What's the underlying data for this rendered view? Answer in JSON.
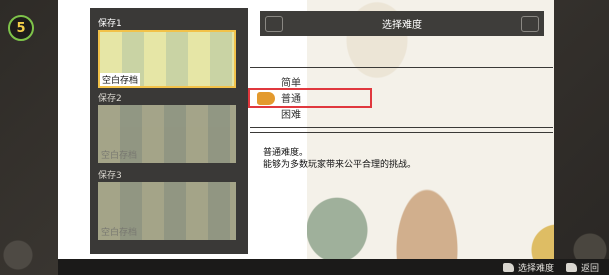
{
  "header": {
    "title": "选择难度"
  },
  "save_slots": [
    {
      "label": "保存1",
      "status": "空白存档",
      "selected": true
    },
    {
      "label": "保存2",
      "status": "空白存档",
      "selected": false
    },
    {
      "label": "保存3",
      "status": "空白存档",
      "selected": false
    }
  ],
  "difficulty": {
    "options": [
      "简单",
      "普通",
      "困难"
    ],
    "selected": "普通"
  },
  "description": {
    "line1": "普通难度。",
    "line2": "能够为多数玩家带来公平合理的挑战。"
  },
  "footer": {
    "confirm_label": "选择难度",
    "back_label": "返回"
  },
  "colors": {
    "accent_highlight": "#e0383e",
    "selected_slot_border": "#f2c24a",
    "panel": "#3a3937"
  },
  "logo": {
    "text": "5"
  }
}
